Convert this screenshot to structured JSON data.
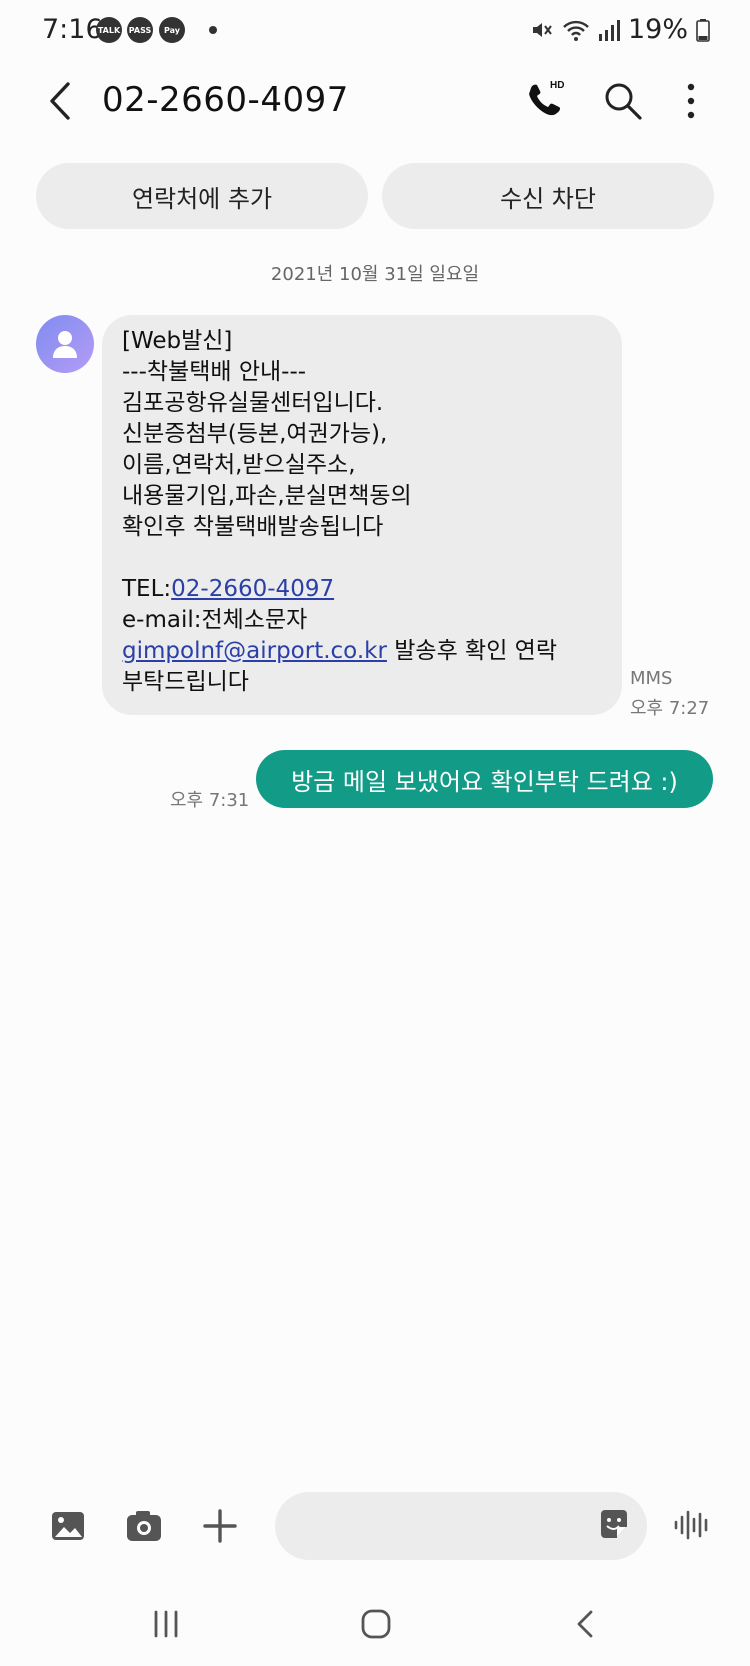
{
  "status_bar": {
    "time": "7:16",
    "badges": [
      "TALK",
      "PASS",
      "Pay"
    ],
    "battery": "19%",
    "icons": [
      "mute-icon",
      "wifi-icon",
      "signal-icon",
      "battery-icon"
    ]
  },
  "header": {
    "title": "02-2660-4097",
    "hd_label": "HD"
  },
  "actions": {
    "add_contact": "연락처에 추가",
    "block": "수신 차단"
  },
  "date_separator": "2021년 10월 31일 일요일",
  "messages": {
    "incoming": {
      "lines": [
        "[Web발신]",
        "---착불택배 안내---",
        "김포공항유실물센터입니다.",
        "신분증첨부(등본,여권가능),",
        "이름,연락처,받으실주소,",
        "내용물기입,파손,분실면책동의",
        "확인후 착불택배발송됩니다"
      ],
      "tel_prefix": "TEL:",
      "tel_link": "02-2660-4097",
      "email_line": "e-mail:전체소문자",
      "email_link": "gimpolnf@airport.co.kr",
      "email_suffix": " 발송후 확인 연락",
      "last_line": "부탁드립니다",
      "type": "MMS",
      "time": "오후 7:27"
    },
    "outgoing": {
      "text": "방금 메일 보냈어요 확인부탁 드려요 :)",
      "time": "오후 7:31"
    }
  },
  "composer": {
    "placeholder": ""
  },
  "colors": {
    "outgoing_bubble": "#129b87",
    "incoming_bubble": "#ececec",
    "link": "#2a3fa8"
  }
}
